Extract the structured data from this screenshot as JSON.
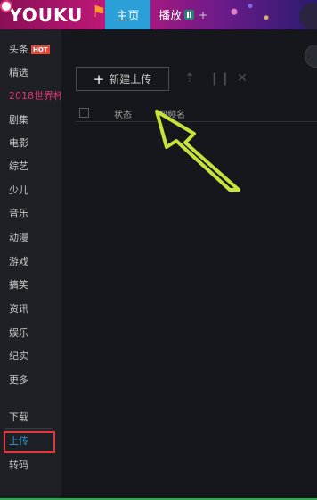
{
  "header": {
    "logo": "YOUKU",
    "tabs": [
      {
        "label": "主页"
      },
      {
        "label": "播放"
      }
    ],
    "add_tab": "+"
  },
  "sidebar": {
    "items": [
      {
        "label": "头条",
        "badge": "HOT"
      },
      {
        "label": "精选"
      },
      {
        "label": "2018世界杯"
      },
      {
        "label": "剧集"
      },
      {
        "label": "电影"
      },
      {
        "label": "综艺"
      },
      {
        "label": "少儿"
      },
      {
        "label": "音乐"
      },
      {
        "label": "动漫"
      },
      {
        "label": "游戏"
      },
      {
        "label": "搞笑"
      },
      {
        "label": "资讯"
      },
      {
        "label": "娱乐"
      },
      {
        "label": "纪实"
      },
      {
        "label": "更多"
      }
    ],
    "bottom_items": [
      {
        "label": "下载"
      },
      {
        "label": "上传"
      },
      {
        "label": "转码"
      }
    ]
  },
  "main": {
    "new_upload_button": "新建上传",
    "columns": {
      "status": "状态",
      "video_name": "视频名"
    }
  },
  "colors": {
    "accent_blue": "#2a9fd8",
    "world_cup_pink": "#e0336f",
    "highlight_red": "#e03a3a",
    "arrow_yellow_green": "#c7e23a"
  }
}
